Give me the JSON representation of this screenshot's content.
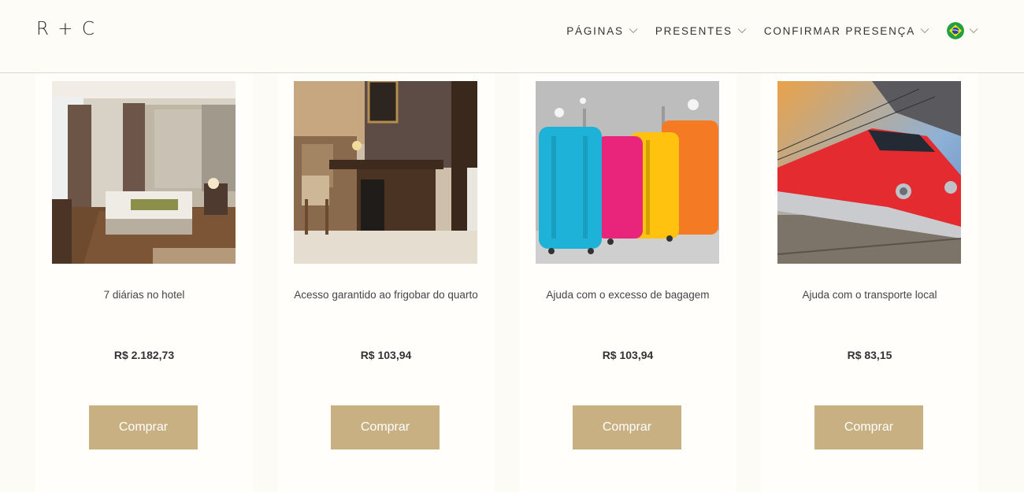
{
  "header": {
    "logo": "R + C",
    "nav": [
      {
        "label": "PÁGINAS"
      },
      {
        "label": "PRESENTES"
      },
      {
        "label": "CONFIRMAR PRESENÇA"
      }
    ],
    "language_flag": "brazil-flag-icon"
  },
  "colors": {
    "accent": "#c9b083",
    "background": "#fcfbf6",
    "card": "#fffefb"
  },
  "products": [
    {
      "title": "7 diárias no hotel",
      "price": "R$ 2.182,73",
      "button": "Comprar",
      "image": "hotel-room-image"
    },
    {
      "title": "Acesso garantido ao frigobar do quarto",
      "price": "R$ 103,94",
      "button": "Comprar",
      "image": "minibar-image"
    },
    {
      "title": "Ajuda com o excesso de bagagem",
      "price": "R$ 103,94",
      "button": "Comprar",
      "image": "suitcases-image"
    },
    {
      "title": "Ajuda com o transporte local",
      "price": "R$ 83,15",
      "button": "Comprar",
      "image": "train-image"
    }
  ]
}
